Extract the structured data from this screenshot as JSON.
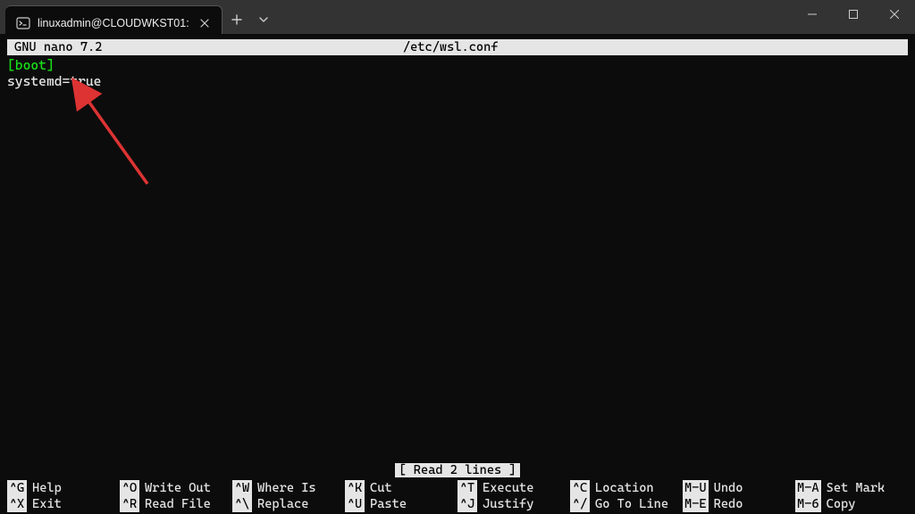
{
  "window": {
    "tab_title": "linuxadmin@CLOUDWKST01:"
  },
  "nano": {
    "app": "GNU nano 7.2",
    "file": "/etc/wsl.conf",
    "status": "[ Read 2 lines ]",
    "lines": {
      "l0": "[boot]",
      "l1": "systemd=true"
    }
  },
  "shortcuts": {
    "r0c0": {
      "key": "^G",
      "label": "Help"
    },
    "r0c1": {
      "key": "^O",
      "label": "Write Out"
    },
    "r0c2": {
      "key": "^W",
      "label": "Where Is"
    },
    "r0c3": {
      "key": "^K",
      "label": "Cut"
    },
    "r0c4": {
      "key": "^T",
      "label": "Execute"
    },
    "r0c5": {
      "key": "^C",
      "label": "Location"
    },
    "r0c6": {
      "key": "M-U",
      "label": "Undo"
    },
    "r0c7": {
      "key": "M-A",
      "label": "Set Mark"
    },
    "r1c0": {
      "key": "^X",
      "label": "Exit"
    },
    "r1c1": {
      "key": "^R",
      "label": "Read File"
    },
    "r1c2": {
      "key": "^\\",
      "label": "Replace"
    },
    "r1c3": {
      "key": "^U",
      "label": "Paste"
    },
    "r1c4": {
      "key": "^J",
      "label": "Justify"
    },
    "r1c5": {
      "key": "^/",
      "label": "Go To Line"
    },
    "r1c6": {
      "key": "M-E",
      "label": "Redo"
    },
    "r1c7": {
      "key": "M-6",
      "label": "Copy"
    }
  }
}
